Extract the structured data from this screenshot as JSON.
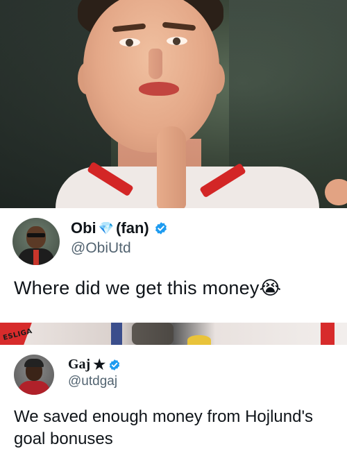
{
  "tweet1": {
    "display_name": "Obi",
    "display_suffix": "(fan)",
    "handle": "@ObiUtd",
    "text": "Where did we get this money",
    "emoji": "😭",
    "diamond_icon": "💎",
    "verified_color": "#1d9bf0"
  },
  "tweet2": {
    "display_name": "Gaj",
    "star": "★",
    "handle": "@utdgaj",
    "line1": "We saved enough money from Hojlund's",
    "line2": "goal bonuses",
    "verified_color": "#1d9bf0"
  },
  "mid_strip": {
    "logo_text": "ESLIGA"
  },
  "icons": {
    "verified": "verified-badge-icon",
    "diamond": "diamond-icon",
    "crying_face": "crying-face-emoji"
  }
}
